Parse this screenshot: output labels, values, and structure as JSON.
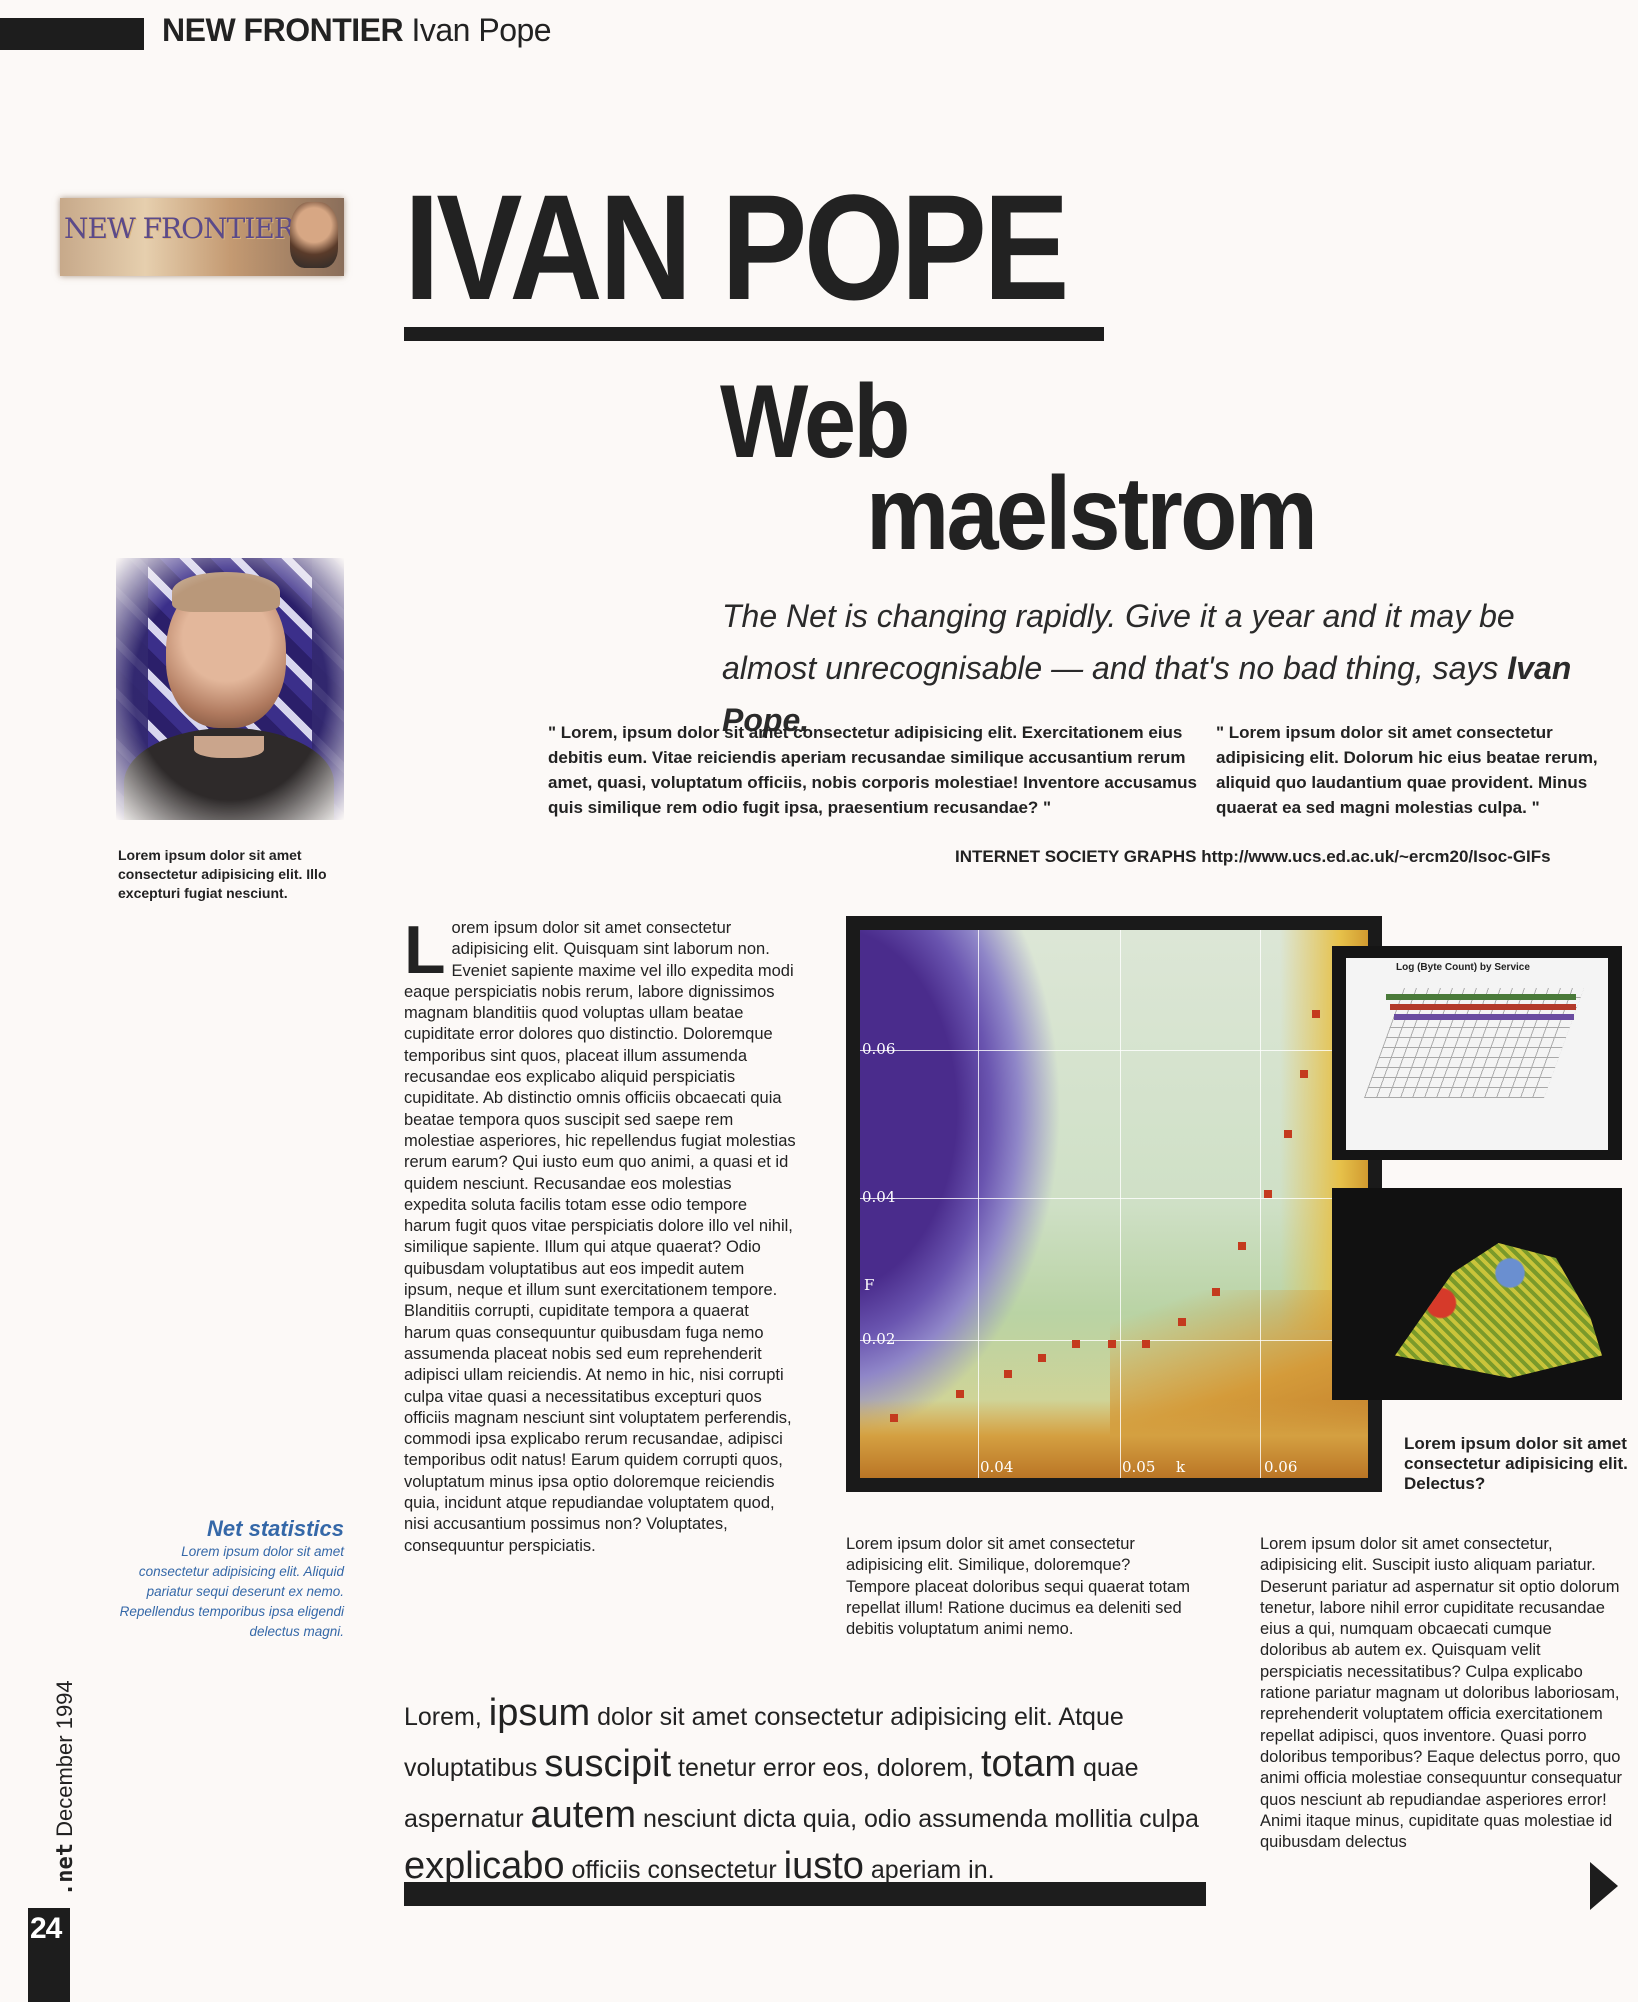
{
  "header": {
    "section": "NEW FRONTIER",
    "author": "Ivan Pope"
  },
  "logo": {
    "text": "NEW FRONTIER"
  },
  "article": {
    "title": "IVAN POPE",
    "subtitle_line1": "Web",
    "subtitle_line2": "maelstrom",
    "standfirst": "The Net is changing rapidly. Give it a year and it may be almost unrecognisable — and that's no bad thing, says ",
    "standfirst_name": "Ivan Pope."
  },
  "portrait_caption": "Lorem ipsum dolor sit amet consectetur adipisicing elit. Illo excepturi fugiat nesciunt.",
  "quotes": [
    "\" Lorem, ipsum dolor sit amet consectetur adipisicing elit. Exercitationem eius debitis eum. Vitae reiciendis aperiam recusandae similique accusantium rerum amet, quasi, voluptatum officiis, nobis corporis molestiae! Inventore accusamus quis similique rem odio fugit ipsa, praesentium recusandae? \"",
    "\" Lorem ipsum dolor sit amet consectetur adipisicing elit. Dolorum hic eius beatae rerum, aliquid quo laudantium quae provident. Minus quaerat ea sed magni molestias culpa. \""
  ],
  "graphs_credit": "INTERNET SOCIETY GRAPHS http://www.ucs.ed.ac.uk/~ercm20/Isoc-GIFs",
  "body": {
    "dropcap": "L",
    "col1": "orem ipsum dolor sit amet consectetur adipisicing elit. Quisquam sint laborum non. Eveniet sapiente maxime vel illo expedita modi eaque perspiciatis nobis rerum, labore dignissimos magnam blanditiis quod voluptas ullam beatae cupiditate error dolores quo distinctio. Doloremque temporibus sint quos, placeat illum assumenda recusandae eos explicabo aliquid perspiciatis cupiditate. Ab distinctio omnis officiis obcaecati quia beatae tempora quos suscipit sed saepe rem molestiae asperiores, hic repellendus fugiat molestias rerum earum? Qui iusto eum quo animi, a quasi et id quidem nesciunt. Recusandae eos molestias expedita soluta facilis totam esse odio tempore harum fugit quos vitae perspiciatis dolore illo vel nihil, similique sapiente. Illum qui atque quaerat? Odio quibusdam voluptatibus aut eos impedit autem ipsum, neque et illum sunt exercitationem tempore. Blanditiis corrupti, cupiditate tempora a quaerat harum quas consequuntur quibusdam fuga nemo assumenda placeat nobis sed eum reprehenderit adipisci ullam reiciendis. At nemo in hic, nisi corrupti culpa vitae quasi a necessitatibus excepturi quos officiis magnam nesciunt sint voluptatem perferendis, commodi ipsa explicabo rerum recusandae, adipisci temporibus odit natus! Earum quidem corrupti quos, voluptatum minus ipsa optio doloremque reiciendis quia, incidunt atque repudiandae voluptatem quod, nisi accusantium possimus non? Voluptates, consequuntur perspiciatis.",
    "col2": "Lorem ipsum dolor sit amet consectetur adipisicing elit. Similique, doloremque? Tempore placeat doloribus sequi quaerat totam repellat illum! Ratione ducimus ea deleniti sed debitis voluptatum animi nemo.",
    "col3": "Lorem ipsum dolor sit amet consectetur, adipisicing elit. Suscipit iusto aliquam pariatur. Deserunt pariatur ad aspernatur sit optio dolorum tenetur, labore nihil error cupiditate recusandae eius a qui, numquam obcaecati cumque doloribus ab autem ex. Quisquam velit perspiciatis necessitatibus? Culpa explicabo ratione pariatur magnam ut doloribus laboriosam, reprehenderit voluptatem officia exercitationem repellat adipisci, quos inventore. Quasi porro doloribus temporibus? Eaque delectus porro, quo animi officia molestiae consequuntur consequatur quos nesciunt ab repudiandae asperiores error! Animi itaque minus, cupiditate quas molestiae id quibusdam delectus"
  },
  "main_graph": {
    "y_ticks": [
      "0.06",
      "0.04",
      "0.02"
    ],
    "y_label": "F",
    "x_ticks": [
      "0.04",
      "0.05",
      "0.06"
    ],
    "x_label": "k"
  },
  "log_graph": {
    "title": "Log (Byte Count) by Service"
  },
  "graph_caption": "Lorem ipsum dolor sit amet consectetur adipisicing elit. Delectus?",
  "net_statistics": {
    "title": "Net statistics",
    "text": "Lorem ipsum dolor sit amet consectetur adipisicing elit. Aliquid pariatur sequi deserunt ex nemo. Repellendus temporibus ipsa eligendi delectus magni."
  },
  "pull_text": [
    {
      "t": "Lorem, ",
      "big": false
    },
    {
      "t": "ipsum",
      "big": true
    },
    {
      "t": " dolor sit amet consectetur adipisicing elit. Atque voluptatibus ",
      "big": false
    },
    {
      "t": "suscipit",
      "big": true
    },
    {
      "t": " tenetur error eos, dolorem, ",
      "big": false
    },
    {
      "t": "totam",
      "big": true
    },
    {
      "t": " quae aspernatur ",
      "big": false
    },
    {
      "t": "autem",
      "big": true
    },
    {
      "t": " nesciunt dicta quia, odio assumenda mollitia culpa ",
      "big": false
    },
    {
      "t": "explicabo",
      "big": true
    },
    {
      "t": " officiis consectetur ",
      "big": false
    },
    {
      "t": "iusto",
      "big": true
    },
    {
      "t": " aperiam in.",
      "big": false
    }
  ],
  "folio": {
    "page": "24",
    "brand": ".net",
    "date": "December 1994"
  }
}
